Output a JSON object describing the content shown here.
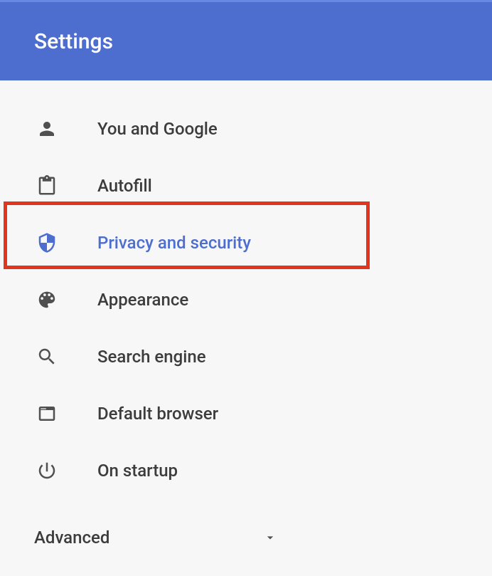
{
  "header": {
    "title": "Settings"
  },
  "sidebar": {
    "items": [
      {
        "label": "You and Google"
      },
      {
        "label": "Autofill"
      },
      {
        "label": "Privacy and security"
      },
      {
        "label": "Appearance"
      },
      {
        "label": "Search engine"
      },
      {
        "label": "Default browser"
      },
      {
        "label": "On startup"
      }
    ]
  },
  "advanced": {
    "label": "Advanced"
  }
}
